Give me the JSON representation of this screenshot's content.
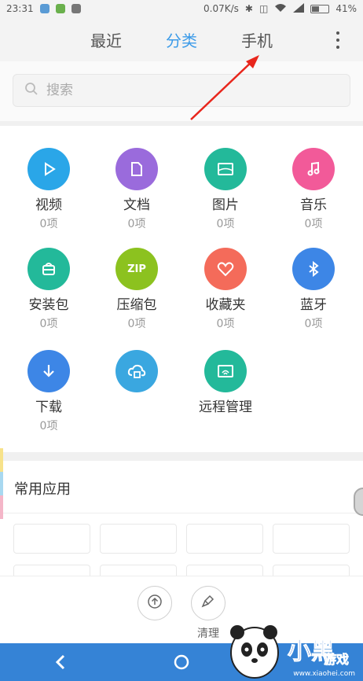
{
  "status_bar": {
    "time": "23:31",
    "network_speed": "0.07K/s",
    "battery": "41%",
    "battery_level": 0.41
  },
  "tabs": [
    {
      "label": "最近",
      "active": false
    },
    {
      "label": "分类",
      "active": true
    },
    {
      "label": "手机",
      "active": false
    }
  ],
  "search": {
    "placeholder": "搜索"
  },
  "categories": [
    {
      "name": "视频",
      "count": "0项",
      "color": "#2aa6e8",
      "icon": "play-icon"
    },
    {
      "name": "文档",
      "count": "0项",
      "color": "#9a6bdc",
      "icon": "document-icon"
    },
    {
      "name": "图片",
      "count": "0项",
      "color": "#23b99a",
      "icon": "image-icon"
    },
    {
      "name": "音乐",
      "count": "0项",
      "color": "#f25a99",
      "icon": "music-icon"
    },
    {
      "name": "安装包",
      "count": "0项",
      "color": "#23b99a",
      "icon": "package-icon"
    },
    {
      "name": "压缩包",
      "count": "0项",
      "color": "#8cc21f",
      "icon": "zip-icon",
      "icon_text": "ZIP"
    },
    {
      "name": "收藏夹",
      "count": "0项",
      "color": "#f46b5a",
      "icon": "heart-icon"
    },
    {
      "name": "蓝牙",
      "count": "0项",
      "color": "#3d86e6",
      "icon": "bluetooth-icon"
    },
    {
      "name": "下载",
      "count": "0项",
      "color": "#3d86e6",
      "icon": "download-icon"
    },
    {
      "name": "",
      "count": "",
      "color": "#3aa7e0",
      "icon": "cloud-icon",
      "blurred": true
    },
    {
      "name": "远程管理",
      "count": "",
      "color": "#23b99a",
      "icon": "remote-icon"
    }
  ],
  "common_apps": {
    "title": "常用应用",
    "apps": [
      "",
      "",
      "",
      "",
      "",
      "",
      "",
      ""
    ]
  },
  "actions": [
    {
      "label": "",
      "icon": "upload-icon",
      "blurred": true
    },
    {
      "label": "清理",
      "icon": "broom-icon"
    }
  ],
  "nav": {
    "back": "back-icon",
    "home": "home-icon"
  },
  "watermark": {
    "text": "www.xiaohei.com",
    "logo_text": "小黑游戏"
  }
}
